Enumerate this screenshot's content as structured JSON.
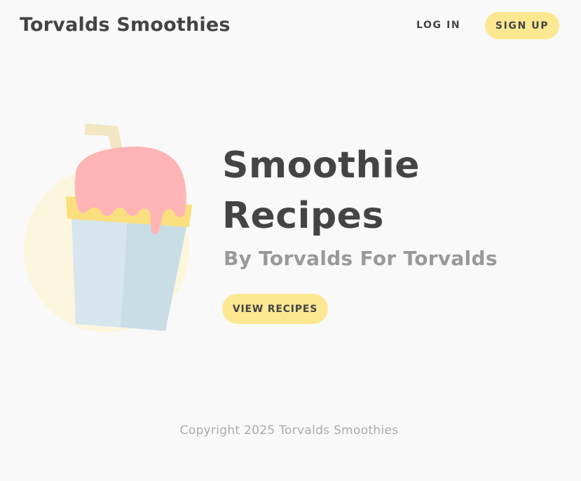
{
  "header": {
    "brand": "Torvalds Smoothies",
    "login_label": "LOG IN",
    "signup_label": "SIGN UP"
  },
  "hero": {
    "title_line1": "Smoothie",
    "title_line2": "Recipes",
    "subtitle": "By Torvalds For Torvalds",
    "cta_label": "VIEW RECIPES",
    "illustration_icon": "smoothie-cup-icon"
  },
  "footer": {
    "copyright": "Copyright 2025 Torvalds Smoothies"
  },
  "colors": {
    "background": "#f9f9fa",
    "accent": "#fde892",
    "text": "#444444",
    "muted": "#999999"
  }
}
